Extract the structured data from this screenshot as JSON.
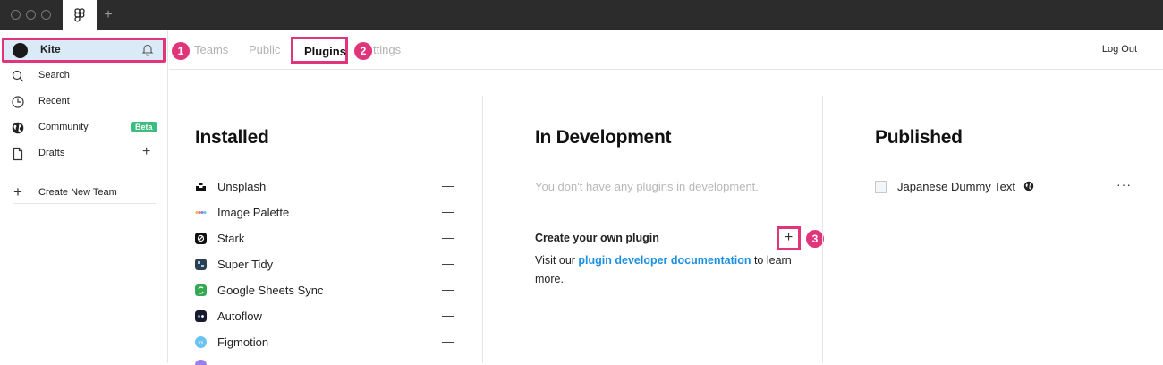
{
  "titlebar": {
    "new_tab": "+"
  },
  "sidebar": {
    "user_name": "Kite",
    "items": [
      {
        "label": "Search",
        "icon": "search-icon"
      },
      {
        "label": "Recent",
        "icon": "clock-icon"
      },
      {
        "label": "Community",
        "icon": "globe-icon",
        "badge": "Beta"
      },
      {
        "label": "Drafts",
        "icon": "file-icon",
        "action": "+"
      }
    ],
    "create_team": "Create New Team",
    "create_team_icon": "+"
  },
  "markers": [
    "1",
    "2",
    "3"
  ],
  "topnav": {
    "tabs": [
      "Teams",
      "Public",
      "Plugins",
      "ttings"
    ],
    "active_tab": "Plugins",
    "logout": "Log Out"
  },
  "installed": {
    "title": "Installed",
    "remove_symbol": "—",
    "plugins": [
      {
        "name": "Unsplash",
        "color": "#111111"
      },
      {
        "name": "Image Palette",
        "color": "#e8a0c8"
      },
      {
        "name": "Stark",
        "color": "#111111"
      },
      {
        "name": "Super Tidy",
        "color": "#2c3e50"
      },
      {
        "name": "Google Sheets Sync",
        "color": "#34a853"
      },
      {
        "name": "Autoflow",
        "color": "#1a1a2e"
      },
      {
        "name": "Figmotion",
        "color": "#6cc3ef"
      }
    ]
  },
  "in_development": {
    "title": "In Development",
    "empty_text": "You don't have any plugins in development.",
    "create_title": "Create your own plugin",
    "create_add": "+",
    "create_text_before": "Visit our ",
    "create_link": "plugin developer documentation",
    "create_text_after": " to learn more."
  },
  "published": {
    "title": "Published",
    "plugin_name": "Japanese Dummy Text",
    "more": "···"
  },
  "colors": {
    "accent": "#e0357a",
    "link": "#1a8fe3",
    "badge": "#3bbd7e",
    "selected": "#daebf7"
  }
}
